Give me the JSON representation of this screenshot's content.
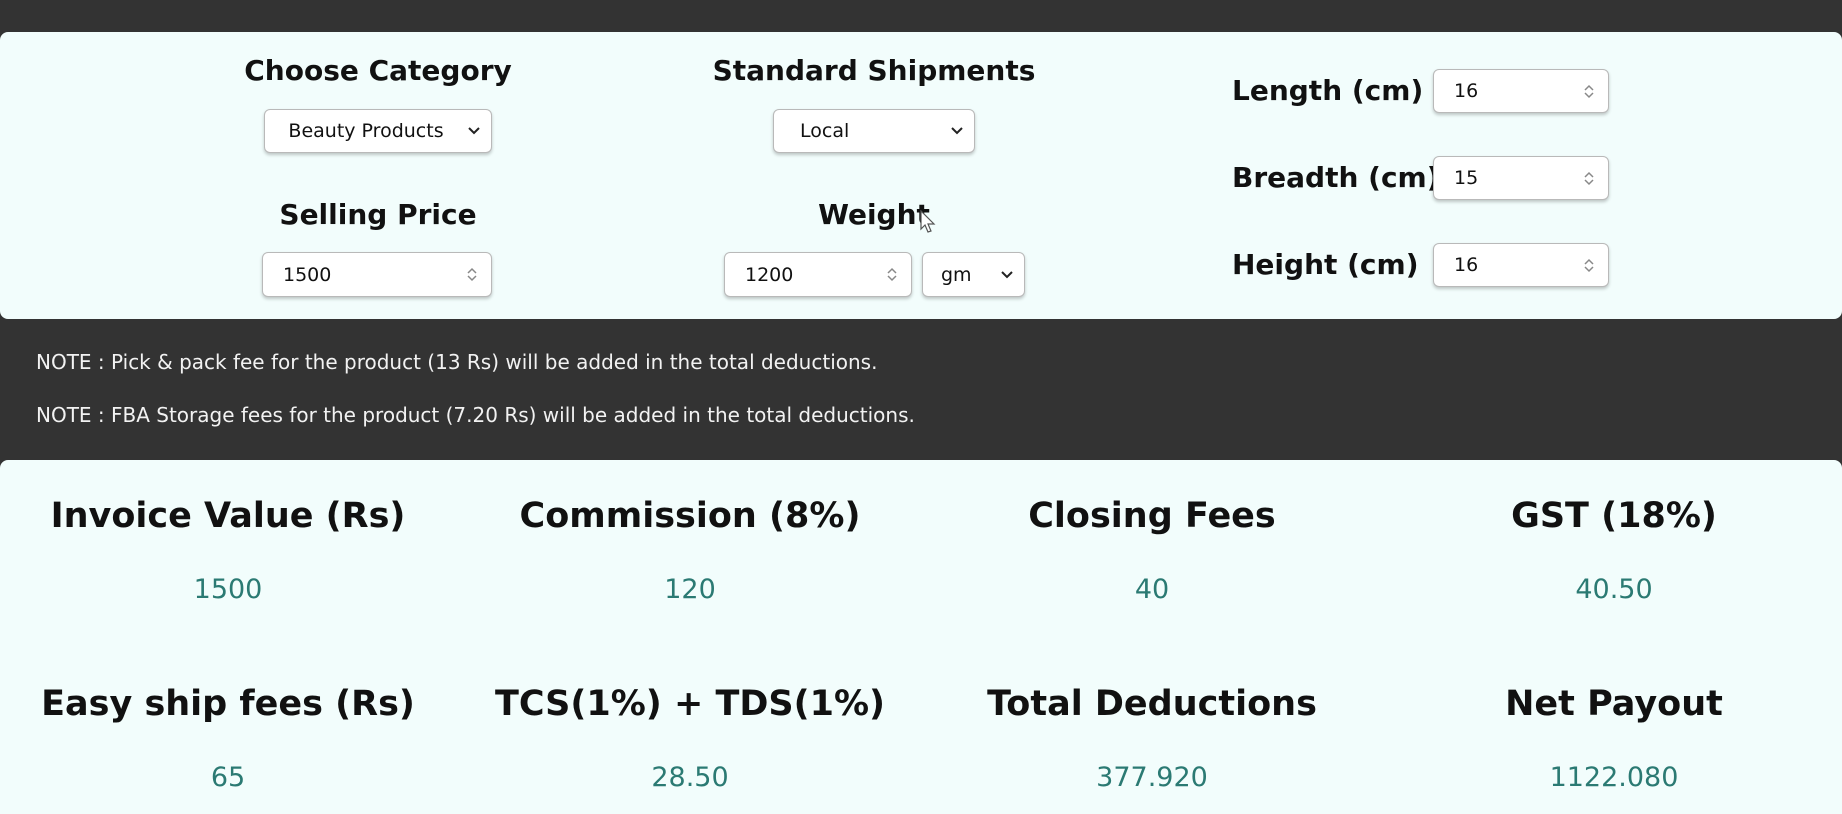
{
  "inputs": {
    "category": {
      "label": "Choose Category",
      "value": "Beauty Products"
    },
    "shipment": {
      "label": "Standard Shipments",
      "value": "Local"
    },
    "selling_price": {
      "label": "Selling Price",
      "value": "1500"
    },
    "weight": {
      "label": "Weight",
      "value": "1200",
      "unit": "gm"
    },
    "length": {
      "label": "Length (cm)",
      "value": "16"
    },
    "breadth": {
      "label": "Breadth (cm)",
      "value": "15"
    },
    "height": {
      "label": "Height (cm)",
      "value": "16"
    }
  },
  "notes": [
    "NOTE : Pick & pack fee for the product (13 Rs) will be added in the total deductions.",
    "NOTE : FBA Storage fees for the product (7.20 Rs) will be added in the total deductions."
  ],
  "results": [
    {
      "label": "Invoice Value (Rs)",
      "value": "1500"
    },
    {
      "label": "Commission (8%)",
      "value": "120"
    },
    {
      "label": "Closing Fees",
      "value": "40"
    },
    {
      "label": "GST (18%)",
      "value": "40.50"
    },
    {
      "label": "Easy ship fees (Rs)",
      "value": "65"
    },
    {
      "label": "TCS(1%) + TDS(1%)",
      "value": "28.50"
    },
    {
      "label": "Total Deductions",
      "value": "377.920"
    },
    {
      "label": "Net Payout",
      "value": "1122.080"
    }
  ],
  "colors": {
    "background": "#333333",
    "panel": "#f2fdfc",
    "value_text": "#2b7a73"
  }
}
